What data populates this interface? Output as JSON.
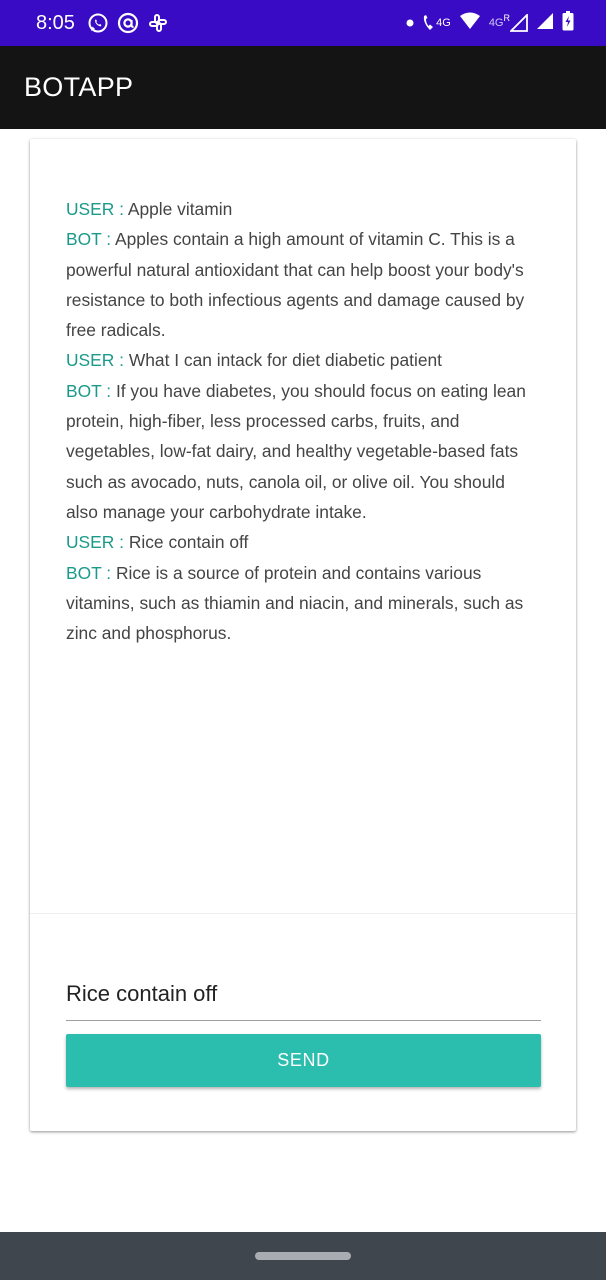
{
  "status_bar": {
    "time": "8:05",
    "left_icons": [
      "whatsapp-icon",
      "at-sign-icon",
      "slack-icon"
    ],
    "network_labels": [
      "4G",
      "4G"
    ],
    "roaming_label": "R",
    "background": "#3a0bc4"
  },
  "app_bar": {
    "title": "BOTAPP",
    "background": "#141414"
  },
  "chat": {
    "messages": [
      {
        "speaker": "USER :",
        "text": " Apple vitamin"
      },
      {
        "speaker": "BOT :",
        "text": " Apples contain a high amount of vitamin C. This is a powerful natural antioxidant that can help boost your body's resistance to both infectious agents and damage caused by free radicals."
      },
      {
        "speaker": "USER :",
        "text": " What I can intack for diet diabetic patient"
      },
      {
        "speaker": "BOT :",
        "text": " If you have diabetes, you should focus on eating lean protein, high-fiber, less processed carbs, fruits, and vegetables, low-fat dairy, and healthy vegetable-based fats such as avocado, nuts, canola oil, or olive oil. You should also manage your carbohydrate intake."
      },
      {
        "speaker": "USER :",
        "text": " Rice contain off"
      },
      {
        "speaker": "BOT :",
        "text": " Rice is a source of protein and contains various vitamins, such as thiamin and niacin, and minerals, such as zinc and phosphorus."
      }
    ],
    "speaker_color": "#1a9a8a"
  },
  "input": {
    "value": "Rice contain off"
  },
  "send_button": {
    "label": "SEND",
    "color": "#2bbdad"
  }
}
